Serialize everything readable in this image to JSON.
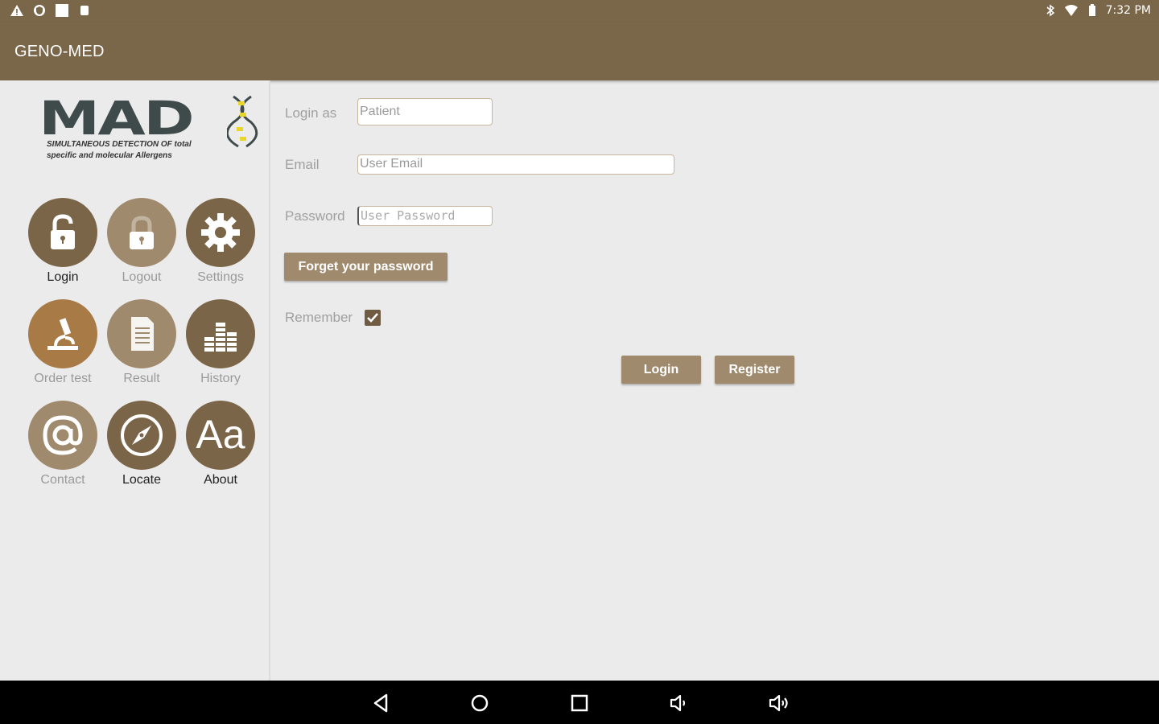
{
  "status_bar": {
    "time": "7:32 PM",
    "left_icons": [
      "warning-icon",
      "shield-icon",
      "image-icon",
      "notification-icon"
    ],
    "right_icons": [
      "bluetooth-icon",
      "wifi-icon",
      "battery-icon"
    ]
  },
  "toolbar": {
    "title": "GENO-MED"
  },
  "logo": {
    "main": "MAD",
    "line1": "SIMULTANEOUS DETECTION OF total",
    "line2": "specific and molecular Allergens"
  },
  "menu": {
    "items": [
      {
        "label": "Login",
        "icon": "unlock-icon"
      },
      {
        "label": "Logout",
        "icon": "lock-icon"
      },
      {
        "label": "Settings",
        "icon": "gear-icon"
      },
      {
        "label": "Order test",
        "icon": "microscope-icon"
      },
      {
        "label": "Result",
        "icon": "document-icon"
      },
      {
        "label": "History",
        "icon": "bar-chart-icon"
      },
      {
        "label": "Contact",
        "icon": "at-icon"
      },
      {
        "label": "Locate",
        "icon": "compass-icon"
      },
      {
        "label": "About",
        "icon": "font-icon"
      }
    ]
  },
  "form": {
    "login_as_label": "Login as",
    "login_as_value": "Patient",
    "email_label": "Email",
    "email_placeholder": "User Email",
    "password_label": "Password",
    "password_placeholder": "User Password",
    "forgot_button": "Forget your password",
    "remember_label": "Remember",
    "remember_checked": true,
    "login_button": "Login",
    "register_button": "Register"
  },
  "colors": {
    "primary": "#7a6649",
    "button": "#a08a6d",
    "accent_orange": "#a87a46",
    "background": "#ebebeb"
  },
  "nav_bar": {
    "icons": [
      "back-icon",
      "home-icon",
      "recents-icon",
      "volume-down-icon",
      "volume-up-icon"
    ]
  }
}
